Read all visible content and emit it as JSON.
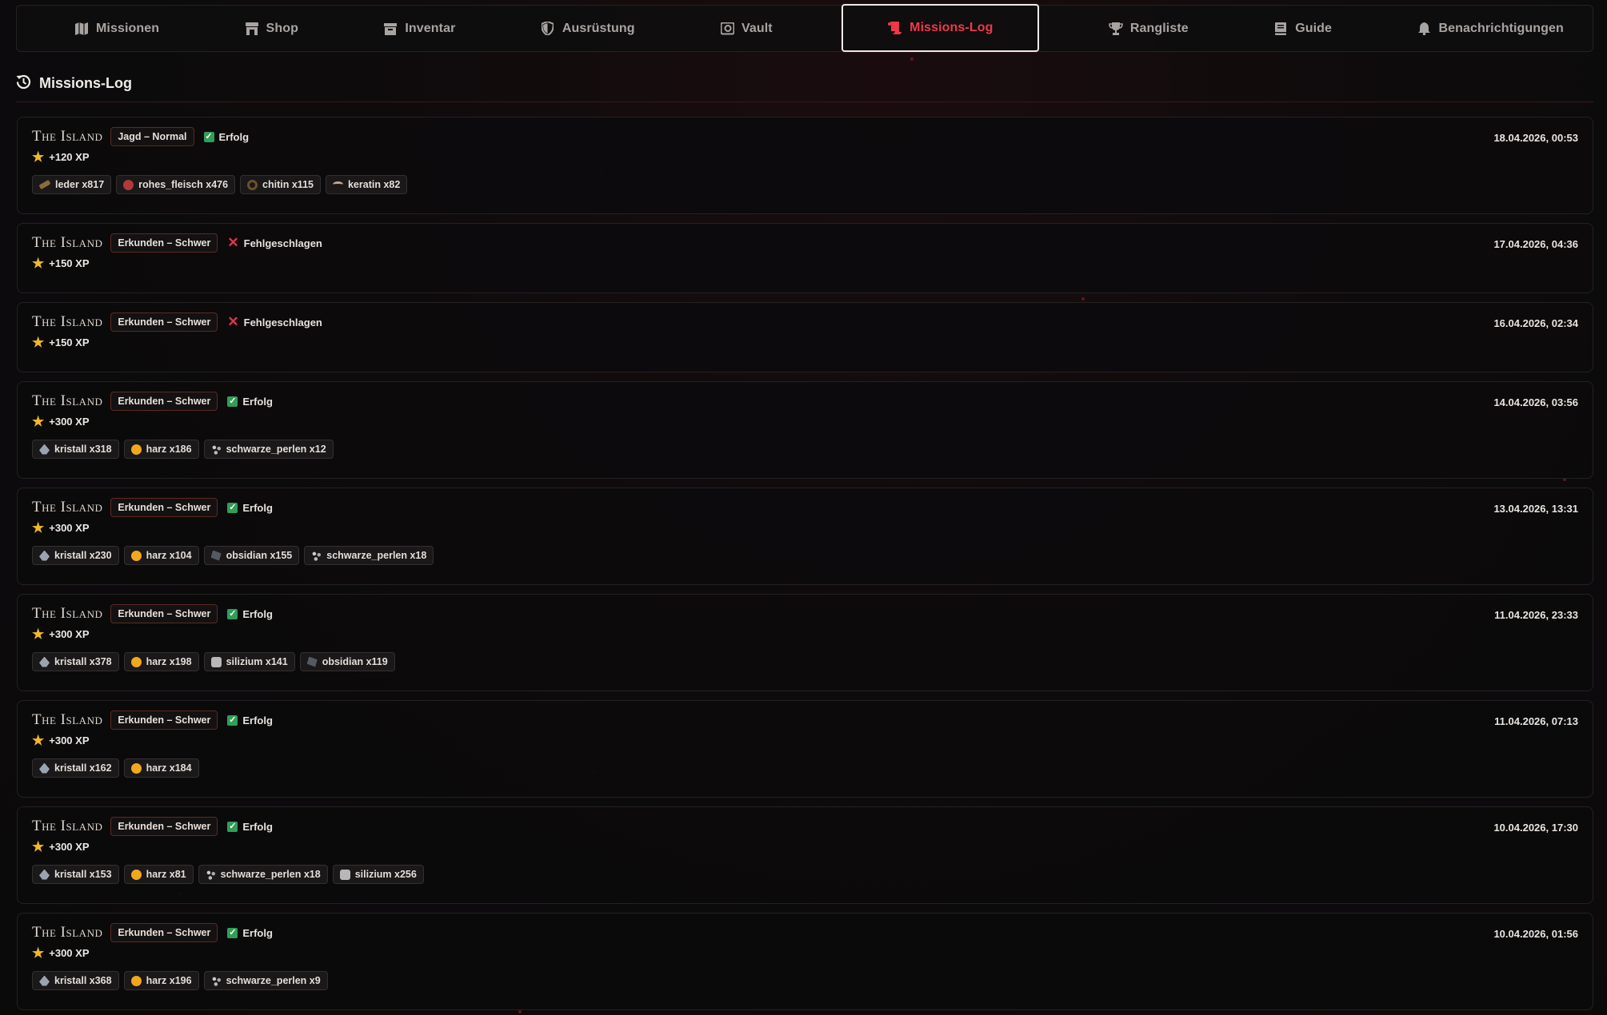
{
  "nav": {
    "tabs": [
      {
        "label": "Missionen",
        "icon": "map-icon"
      },
      {
        "label": "Shop",
        "icon": "store-icon"
      },
      {
        "label": "Inventar",
        "icon": "archive-icon"
      },
      {
        "label": "Ausrüstung",
        "icon": "shield-icon"
      },
      {
        "label": "Vault",
        "icon": "vault-icon"
      },
      {
        "label": "Missions-Log",
        "icon": "scroll-icon",
        "active": true
      },
      {
        "label": "Rangliste",
        "icon": "trophy-icon"
      },
      {
        "label": "Guide",
        "icon": "book-icon"
      },
      {
        "label": "Benachrichtigungen",
        "icon": "bell-icon"
      }
    ]
  },
  "section": {
    "title": "Missions-Log",
    "icon": "history-icon"
  },
  "colors": {
    "accent": "#f0384a",
    "success": "#2f9e56",
    "fail": "#e2354a",
    "xp_star": "#f2b928"
  },
  "entries": [
    {
      "map": "The Island",
      "mode": "Jagd – Normal",
      "status": "Erfolg",
      "success": true,
      "date": "18.04.2026, 00:53",
      "xp": "+120 XP",
      "resources": [
        {
          "label": "leder x817",
          "icon": "leder"
        },
        {
          "label": "rohes_fleisch x476",
          "icon": "fleisch"
        },
        {
          "label": "chitin x115",
          "icon": "chitin"
        },
        {
          "label": "keratin x82",
          "icon": "keratin"
        }
      ]
    },
    {
      "map": "The Island",
      "mode": "Erkunden – Schwer",
      "status": "Fehlgeschlagen",
      "success": false,
      "date": "17.04.2026, 04:36",
      "xp": "+150 XP",
      "resources": []
    },
    {
      "map": "The Island",
      "mode": "Erkunden – Schwer",
      "status": "Fehlgeschlagen",
      "success": false,
      "date": "16.04.2026, 02:34",
      "xp": "+150 XP",
      "resources": []
    },
    {
      "map": "The Island",
      "mode": "Erkunden – Schwer",
      "status": "Erfolg",
      "success": true,
      "date": "14.04.2026, 03:56",
      "xp": "+300 XP",
      "resources": [
        {
          "label": "kristall x318",
          "icon": "kristall"
        },
        {
          "label": "harz x186",
          "icon": "harz"
        },
        {
          "label": "schwarze_perlen x12",
          "icon": "perlen"
        }
      ]
    },
    {
      "map": "The Island",
      "mode": "Erkunden – Schwer",
      "status": "Erfolg",
      "success": true,
      "date": "13.04.2026, 13:31",
      "xp": "+300 XP",
      "resources": [
        {
          "label": "kristall x230",
          "icon": "kristall"
        },
        {
          "label": "harz x104",
          "icon": "harz"
        },
        {
          "label": "obsidian x155",
          "icon": "obsidian"
        },
        {
          "label": "schwarze_perlen x18",
          "icon": "perlen"
        }
      ]
    },
    {
      "map": "The Island",
      "mode": "Erkunden – Schwer",
      "status": "Erfolg",
      "success": true,
      "date": "11.04.2026, 23:33",
      "xp": "+300 XP",
      "resources": [
        {
          "label": "kristall x378",
          "icon": "kristall"
        },
        {
          "label": "harz x198",
          "icon": "harz"
        },
        {
          "label": "silizium x141",
          "icon": "silizium"
        },
        {
          "label": "obsidian x119",
          "icon": "obsidian"
        }
      ]
    },
    {
      "map": "The Island",
      "mode": "Erkunden – Schwer",
      "status": "Erfolg",
      "success": true,
      "date": "11.04.2026, 07:13",
      "xp": "+300 XP",
      "resources": [
        {
          "label": "kristall x162",
          "icon": "kristall"
        },
        {
          "label": "harz x184",
          "icon": "harz"
        }
      ]
    },
    {
      "map": "The Island",
      "mode": "Erkunden – Schwer",
      "status": "Erfolg",
      "success": true,
      "date": "10.04.2026, 17:30",
      "xp": "+300 XP",
      "resources": [
        {
          "label": "kristall x153",
          "icon": "kristall"
        },
        {
          "label": "harz x81",
          "icon": "harz"
        },
        {
          "label": "schwarze_perlen x18",
          "icon": "perlen"
        },
        {
          "label": "silizium x256",
          "icon": "silizium"
        }
      ]
    },
    {
      "map": "The Island",
      "mode": "Erkunden – Schwer",
      "status": "Erfolg",
      "success": true,
      "date": "10.04.2026, 01:56",
      "xp": "+300 XP",
      "resources": [
        {
          "label": "kristall x368",
          "icon": "kristall"
        },
        {
          "label": "harz x196",
          "icon": "harz"
        },
        {
          "label": "schwarze_perlen x9",
          "icon": "perlen"
        }
      ]
    }
  ]
}
